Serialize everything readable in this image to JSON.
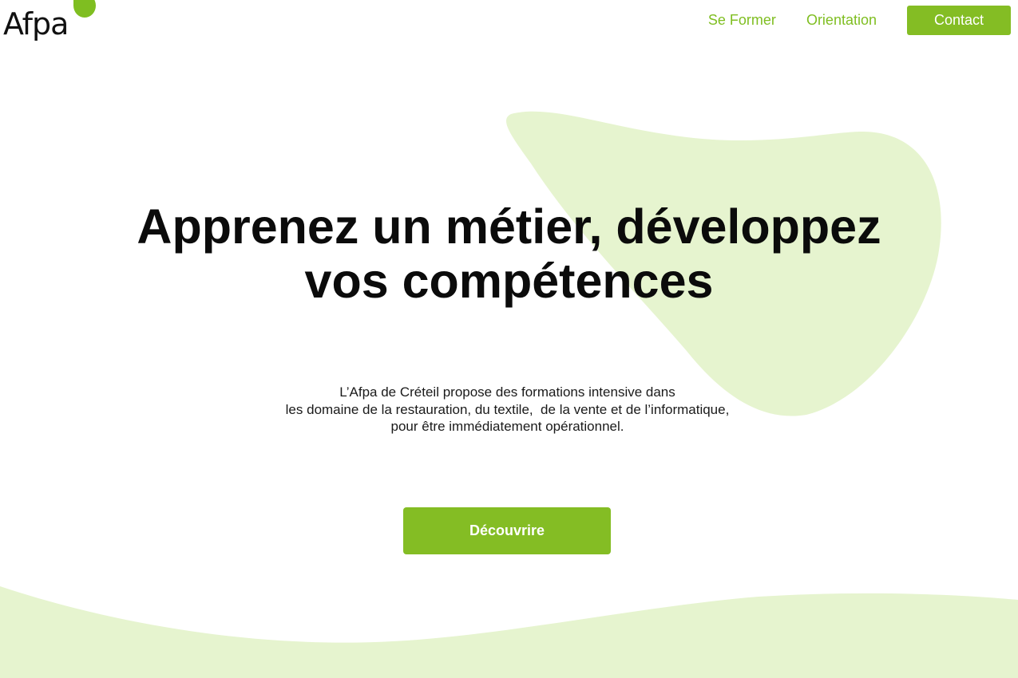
{
  "header": {
    "logo_text": "Afpa",
    "nav": {
      "se_former": "Se Former",
      "orientation": "Orientation",
      "contact": "Contact"
    }
  },
  "hero": {
    "title_lines": [
      "Apprenez un métier, développez",
      "vos compétences"
    ],
    "description_lines": [
      "L’Afpa de Créteil propose des formations intensive dans",
      "les domaine de la restauration, du textile,  de la vente et de l’informatique,",
      "pour être immédiatement opérationnel."
    ],
    "cta_label": "Découvrire"
  },
  "colors": {
    "brand_green": "#84bd24",
    "light_green_shape": "#e6f4cf",
    "text_dark": "#0b0b0b"
  }
}
